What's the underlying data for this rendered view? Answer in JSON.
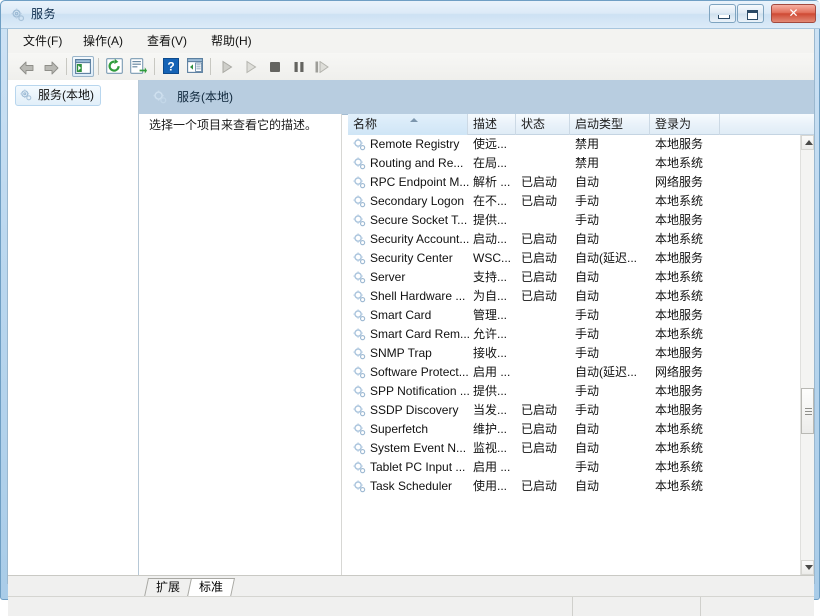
{
  "window": {
    "title": "服务",
    "icon": "services-gear-icon",
    "controls": {
      "minimize": "最小化",
      "maximize": "最大化",
      "close": "关闭",
      "close_glyph": "✕"
    }
  },
  "menubar": {
    "items": [
      {
        "label": "文件(F)",
        "name": "menu-file"
      },
      {
        "label": "操作(A)",
        "name": "menu-action"
      },
      {
        "label": "查看(V)",
        "name": "menu-view"
      },
      {
        "label": "帮助(H)",
        "name": "menu-help"
      }
    ]
  },
  "toolbar": {
    "items": [
      {
        "name": "back-button",
        "icon": "left-arrow-icon",
        "enabled": true
      },
      {
        "name": "forward-button",
        "icon": "right-arrow-icon",
        "enabled": true
      },
      {
        "name": "show-hide-tree-button",
        "icon": "console-tree-icon",
        "enabled": true
      },
      {
        "name": "refresh-button",
        "icon": "refresh-icon",
        "enabled": true
      },
      {
        "name": "export-list-button",
        "icon": "export-list-icon",
        "enabled": true
      },
      {
        "name": "help-button",
        "icon": "question-mark-icon",
        "enabled": true
      },
      {
        "name": "properties-button",
        "icon": "properties-icon",
        "enabled": true
      },
      {
        "name": "start-service-button",
        "icon": "play-icon",
        "enabled": false
      },
      {
        "name": "resume-service-button",
        "icon": "play-outline-icon",
        "enabled": false
      },
      {
        "name": "stop-service-button",
        "icon": "stop-icon",
        "enabled": false
      },
      {
        "name": "pause-service-button",
        "icon": "pause-icon",
        "enabled": false
      },
      {
        "name": "restart-service-button",
        "icon": "restart-icon",
        "enabled": false
      }
    ]
  },
  "tree": {
    "root": {
      "label": "服务(本地)",
      "icon": "services-gear-icon",
      "selected": true
    }
  },
  "pane": {
    "header_title": "服务(本地)",
    "header_icon": "services-gear-icon",
    "description_placeholder": "选择一个项目来查看它的描述。"
  },
  "list": {
    "columns": [
      {
        "label": "名称",
        "name": "column-name",
        "sorted": true,
        "sort_direction": "asc"
      },
      {
        "label": "描述",
        "name": "column-description",
        "sorted": false
      },
      {
        "label": "状态",
        "name": "column-status",
        "sorted": false
      },
      {
        "label": "启动类型",
        "name": "column-startup-type",
        "sorted": false
      },
      {
        "label": "登录为",
        "name": "column-log-on-as",
        "sorted": false
      }
    ],
    "rows": [
      {
        "name": "Remote Registry",
        "description": "使远...",
        "status": "",
        "startup": "禁用",
        "logon": "本地服务"
      },
      {
        "name": "Routing and Re...",
        "description": "在局...",
        "status": "",
        "startup": "禁用",
        "logon": "本地系统"
      },
      {
        "name": "RPC Endpoint M...",
        "description": "解析 ...",
        "status": "已启动",
        "startup": "自动",
        "logon": "网络服务"
      },
      {
        "name": "Secondary Logon",
        "description": "在不...",
        "status": "已启动",
        "startup": "手动",
        "logon": "本地系统"
      },
      {
        "name": "Secure Socket T...",
        "description": "提供...",
        "status": "",
        "startup": "手动",
        "logon": "本地服务"
      },
      {
        "name": "Security Account...",
        "description": "启动...",
        "status": "已启动",
        "startup": "自动",
        "logon": "本地系统"
      },
      {
        "name": "Security Center",
        "description": "WSC...",
        "status": "已启动",
        "startup": "自动(延迟...",
        "logon": "本地服务"
      },
      {
        "name": "Server",
        "description": "支持...",
        "status": "已启动",
        "startup": "自动",
        "logon": "本地系统"
      },
      {
        "name": "Shell Hardware ...",
        "description": "为自...",
        "status": "已启动",
        "startup": "自动",
        "logon": "本地系统"
      },
      {
        "name": "Smart Card",
        "description": "管理...",
        "status": "",
        "startup": "手动",
        "logon": "本地服务"
      },
      {
        "name": "Smart Card Rem...",
        "description": "允许...",
        "status": "",
        "startup": "手动",
        "logon": "本地系统"
      },
      {
        "name": "SNMP Trap",
        "description": "接收...",
        "status": "",
        "startup": "手动",
        "logon": "本地服务"
      },
      {
        "name": "Software Protect...",
        "description": "启用 ...",
        "status": "",
        "startup": "自动(延迟...",
        "logon": "网络服务"
      },
      {
        "name": "SPP Notification ...",
        "description": "提供...",
        "status": "",
        "startup": "手动",
        "logon": "本地服务"
      },
      {
        "name": "SSDP Discovery",
        "description": "当发...",
        "status": "已启动",
        "startup": "手动",
        "logon": "本地服务"
      },
      {
        "name": "Superfetch",
        "description": "维护...",
        "status": "已启动",
        "startup": "自动",
        "logon": "本地系统"
      },
      {
        "name": "System Event N...",
        "description": "监视...",
        "status": "已启动",
        "startup": "自动",
        "logon": "本地系统"
      },
      {
        "name": "Tablet PC Input ...",
        "description": "启用 ...",
        "status": "",
        "startup": "手动",
        "logon": "本地系统"
      },
      {
        "name": "Task Scheduler",
        "description": "使用...",
        "status": "已启动",
        "startup": "自动",
        "logon": "本地系统"
      }
    ],
    "row_icon": "service-gear-icon"
  },
  "tabs": [
    {
      "label": "扩展",
      "name": "tab-extended",
      "active": false
    },
    {
      "label": "标准",
      "name": "tab-standard",
      "active": true
    }
  ],
  "statusbar": {
    "segments": [
      "",
      "",
      ""
    ]
  },
  "colors": {
    "accent": "#b8cde0",
    "title_gradient_top": "#eaf3fb",
    "close_button": "#cf4a34",
    "header_band": "#b8cde0",
    "gear_icon": "#aec6dd"
  }
}
